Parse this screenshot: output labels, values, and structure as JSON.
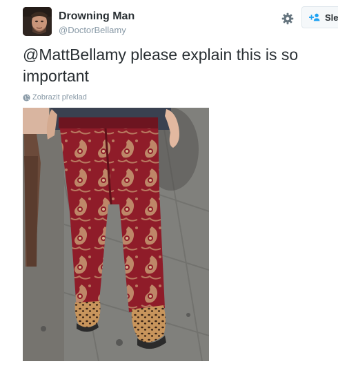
{
  "tweet": {
    "author": {
      "display_name": "Drowning Man",
      "handle": "@DoctorBellamy"
    },
    "mention": "@MattBellamy",
    "text_rest": " please explain this is so important",
    "translate_label": "Zobrazit překlad"
  },
  "actions": {
    "follow_label": "Sle"
  },
  "colors": {
    "text": "#292f33",
    "muted": "#8899a6",
    "link_blue": "#1da1f2",
    "border": "#e1e8ed",
    "pants_red": "#8f1c29",
    "pants_gold": "#c9a178"
  },
  "icons": {
    "settings": "gear-icon",
    "follow": "follow-user-icon",
    "translate": "globe-icon"
  }
}
